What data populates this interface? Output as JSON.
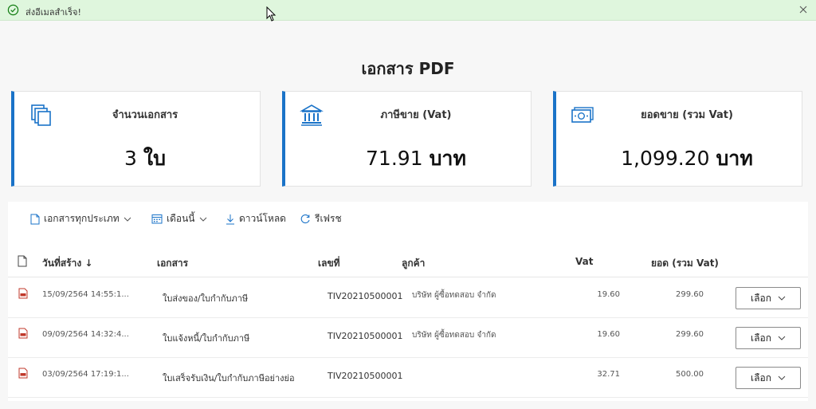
{
  "notification": {
    "message": "ส่งอีเมลสำเร็จ!",
    "icon": "check-circle-icon"
  },
  "page": {
    "title": "เอกสาร PDF"
  },
  "cards": [
    {
      "label": "จำนวนเอกสาร",
      "value": "3",
      "unit": "ใบ",
      "icon": "documents-icon"
    },
    {
      "label": "ภาษีขาย (Vat)",
      "value": "71.91",
      "unit": "บาท",
      "icon": "bank-icon"
    },
    {
      "label": "ยอดขาย (รวม Vat)",
      "value": "1,099.20",
      "unit": "บาท",
      "icon": "money-icon"
    }
  ],
  "toolbar": {
    "doc_type": "เอกสารทุกประเภท",
    "period": "เดือนนี้",
    "download": "ดาวน์โหลด",
    "refresh": "รีเฟรช"
  },
  "table": {
    "headers": {
      "date": "วันที่สร้าง ↓",
      "document": "เอกสาร",
      "number": "เลขที่",
      "customer": "ลูกค้า",
      "vat": "Vat",
      "total": "ยอด (รวม Vat)"
    },
    "rows": [
      {
        "date": "15/09/2564 14:55:1...",
        "document": "ใบส่งของ/ใบกำกับภาษี",
        "number": "TIV20210500001",
        "customer": "บริษัท ผู้ซื้อทดสอบ จำกัด",
        "vat": "19.60",
        "total": "299.60",
        "action": "เลือก"
      },
      {
        "date": "09/09/2564 14:32:4...",
        "document": "ใบแจ้งหนี้/ใบกำกับภาษี",
        "number": "TIV20210500001",
        "customer": "บริษัท ผู้ซื้อทดสอบ จำกัด",
        "vat": "19.60",
        "total": "299.60",
        "action": "เลือก"
      },
      {
        "date": "03/09/2564 17:19:1...",
        "document": "ใบเสร็จรับเงิน/ใบกำกับภาษีอย่างย่อ",
        "number": "TIV20210500001",
        "customer": "",
        "vat": "32.71",
        "total": "500.00",
        "action": "เลือก"
      }
    ]
  },
  "colors": {
    "accent": "#1a73c8",
    "success_bg": "#dff6dd",
    "success_icon": "#107c10"
  }
}
